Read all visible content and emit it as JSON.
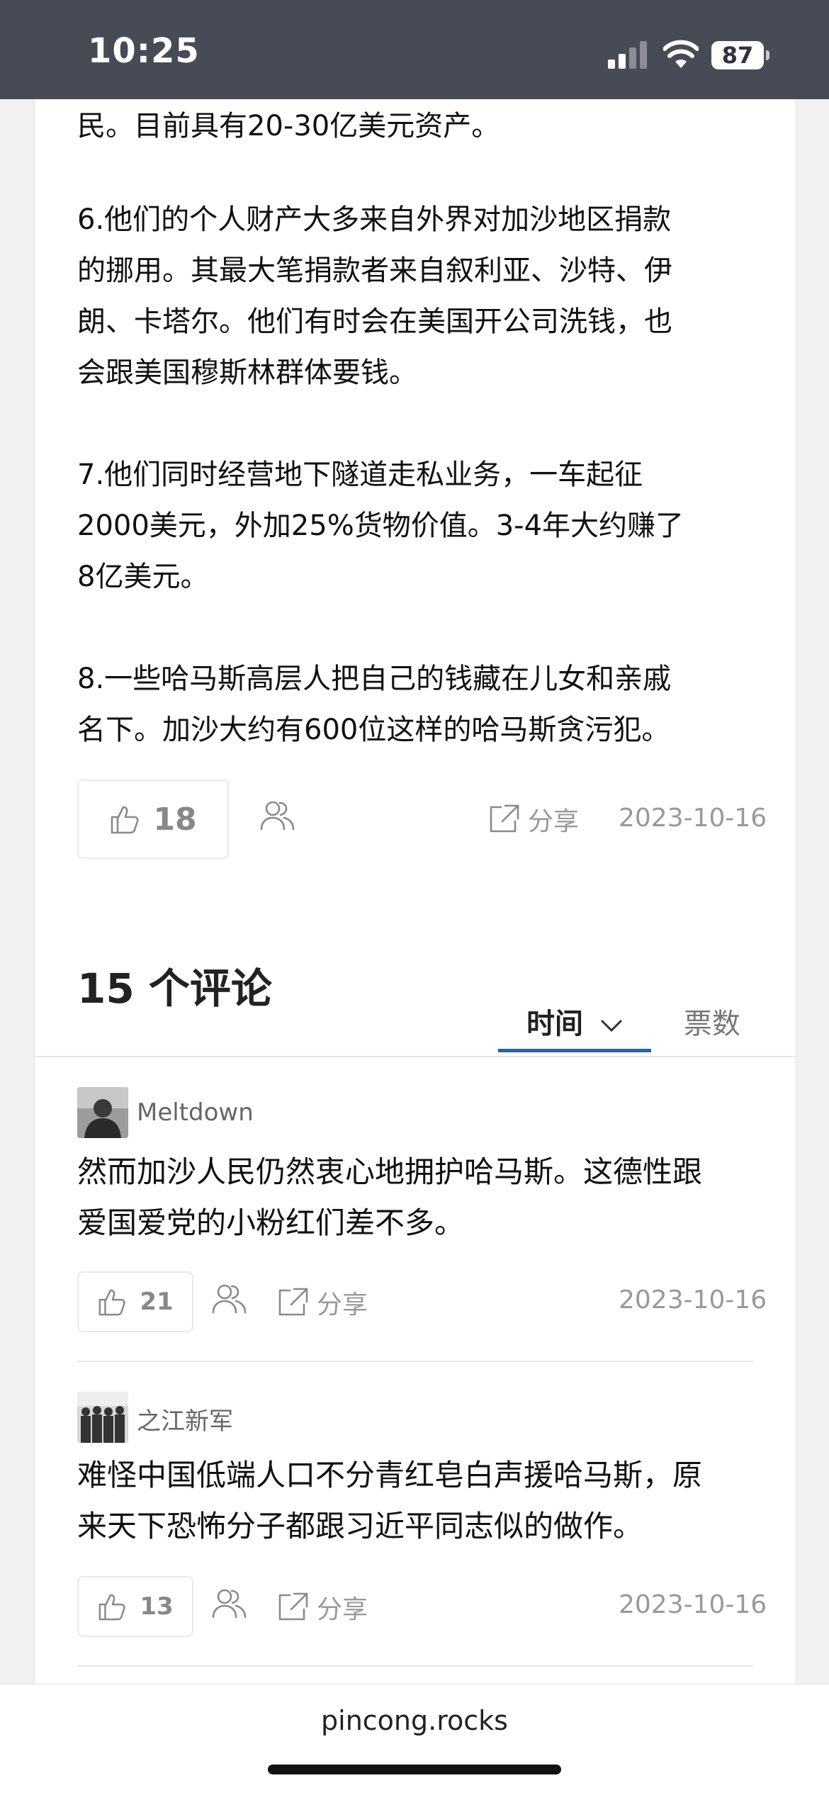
{
  "status_bar": {
    "time": "10:25",
    "battery": "87"
  },
  "article": {
    "paragraphs": [
      "民。目前具有20-30亿美元资产。",
      "6.他们的个人财产大多来自外界对加沙地区捐款\n的挪用。其最大笔捐款者来自叙利亚、沙特、伊\n朗、卡塔尔。他们有时会在美国开公司洗钱，也\n会跟美国穆斯林群体要钱。",
      "7.他们同时经营地下隧道走私业务，一车起征\n2000美元，外加25%货物价值。3-4年大约赚了\n8亿美元。",
      "8.一些哈马斯高层人把自己的钱藏在儿女和亲戚\n名下。加沙大约有600位这样的哈马斯贪污犯。"
    ],
    "likes": "18",
    "share_label": "分享",
    "date": "2023-10-16"
  },
  "comments_section": {
    "title": "15 个评论",
    "tabs": [
      "时间",
      "票数"
    ],
    "active_tab": "时间",
    "accent_color": "#2a62aa"
  },
  "comments": [
    {
      "author": "Meltdown",
      "text": "然而加沙人民仍然衷心地拥护哈马斯。这德性跟\n爱国爱党的小粉红们差不多。",
      "likes": "21",
      "share_label": "分享",
      "date": "2023-10-16"
    },
    {
      "author": "之江新军",
      "text": "难怪中国低端人口不分青红皂白声援哈马斯，原\n来天下恐怖分子都跟习近平同志似的做作。",
      "likes": "13",
      "share_label": "分享",
      "date": "2023-10-16"
    }
  ],
  "browser": {
    "url": "pincong.rocks"
  }
}
